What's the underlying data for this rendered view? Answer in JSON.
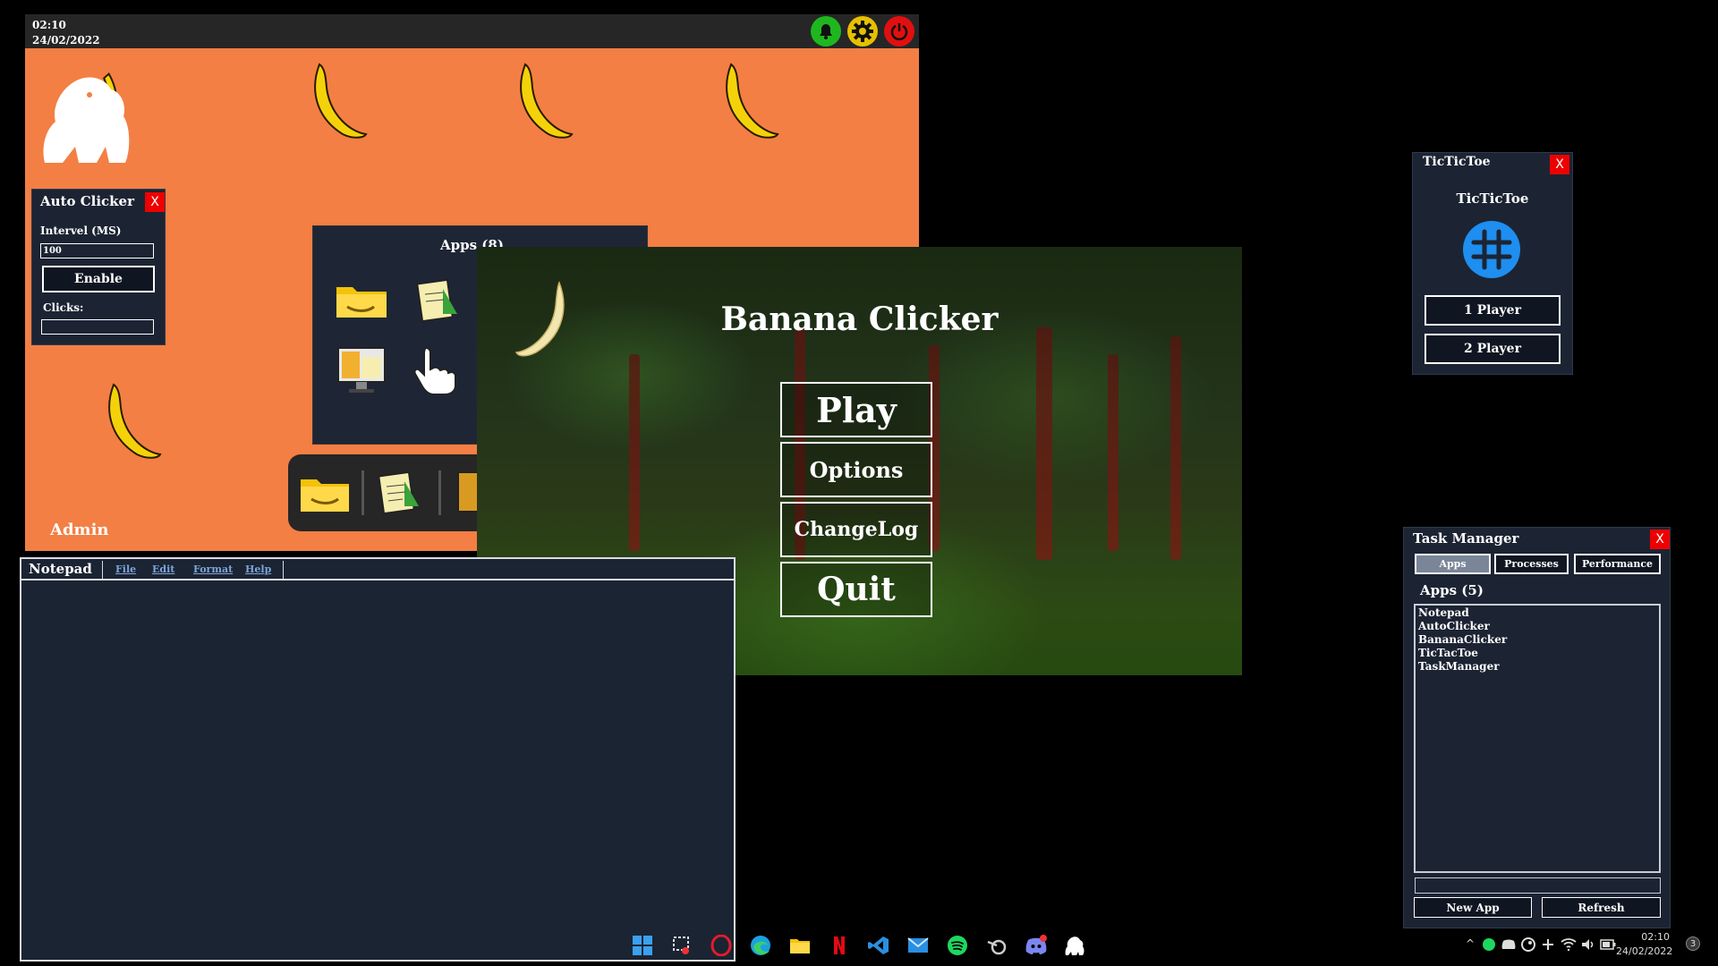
{
  "desktop": {
    "time": "02:10",
    "date": "24/02/2022",
    "user": "Admin",
    "accent_orange": "#f37f44",
    "icons": {
      "notifications": "bell-icon",
      "settings": "gear-icon",
      "power": "power-icon"
    }
  },
  "autoclicker": {
    "title": "Auto Clicker",
    "close": "X",
    "interval_label": "Intervel (MS)",
    "interval_value": "100",
    "enable_label": "Enable",
    "clicks_label": "Clicks:",
    "clicks_value": ""
  },
  "apps_panel": {
    "title": "Apps (8)"
  },
  "banana_clicker": {
    "title": "Banana Clicker",
    "buttons": {
      "play": "Play",
      "options": "Options",
      "changelog": "ChangeLog",
      "quit": "Quit"
    }
  },
  "tictactoe": {
    "window_title": "TicTicToe",
    "close": "X",
    "heading": "TicTicToe",
    "one_player": "1 Player",
    "two_player": "2 Player"
  },
  "task_manager": {
    "title": "Task Manager",
    "close": "X",
    "tabs": [
      "Apps",
      "Processes",
      "Performance"
    ],
    "list_heading": "Apps (5)",
    "apps": [
      "Notepad",
      "AutoClicker",
      "BananaClicker",
      "TicTacToe",
      "TaskManager"
    ],
    "new_app": "New App",
    "refresh": "Refresh"
  },
  "notepad": {
    "title": "Notepad",
    "menu": [
      "File",
      "Edit",
      "Format",
      "Help"
    ],
    "content": ""
  },
  "taskbar": {
    "time": "02:10",
    "date": "24/02/2022",
    "badge": "3"
  }
}
